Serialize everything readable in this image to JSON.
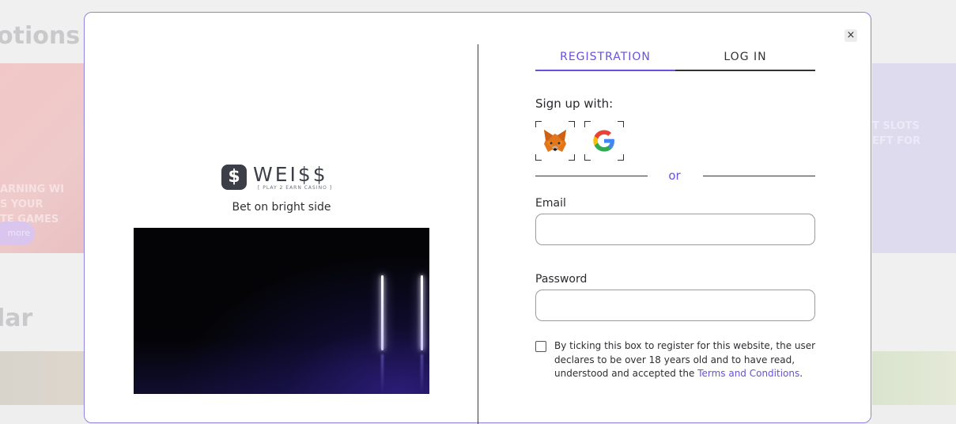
{
  "background": {
    "heading_top": "otions",
    "heading_bottom": "lar",
    "banner_left_text": "ARNING WI\nS YOUR\nTE GAMES",
    "banner_left_more": "more",
    "banner_right_text": "T SLOTS\nEFT FOR"
  },
  "modal": {
    "close_glyph": "×",
    "brand": {
      "mark": "$",
      "name": "WEI$$",
      "subtitle": "[ PLAY 2 EARN CASINO ]",
      "tagline": "Bet on bright side"
    },
    "tabs": [
      {
        "label": "REGISTRATION",
        "active": true
      },
      {
        "label": "LOG IN",
        "active": false
      }
    ],
    "signup_label": "Sign up with:",
    "social_icons": [
      "metamask-icon",
      "google-icon"
    ],
    "or_text": "or",
    "email": {
      "label": "Email",
      "value": "",
      "placeholder": ""
    },
    "password": {
      "label": "Password",
      "value": "",
      "placeholder": ""
    },
    "terms": {
      "text": "By ticking this box to register for this website, the user declares to be over 18 years old and to have read, understood and accepted the ",
      "link": "Terms and Conditions",
      "suffix": "."
    }
  },
  "colors": {
    "accent": "#6a4fe0",
    "modal_border": "#8f85e0",
    "text": "#2b2b2f"
  }
}
